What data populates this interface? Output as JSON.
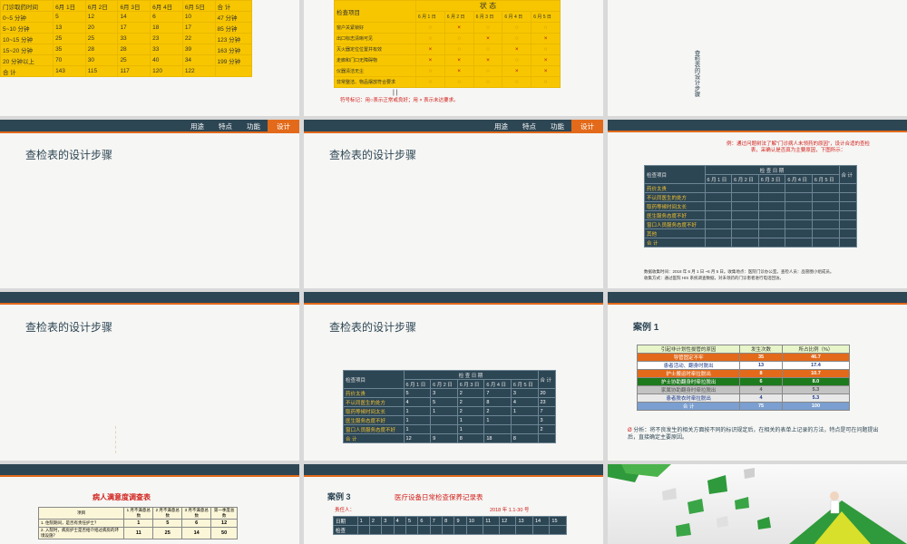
{
  "nav": {
    "items": [
      "用途",
      "特点",
      "功能",
      "设计"
    ]
  },
  "slide1": {
    "headers": [
      "门诊取药时间",
      "6月 1日",
      "6月 2日",
      "6月 3日",
      "6月 4日",
      "6月 5日",
      "合 计"
    ],
    "rows": [
      [
        "0~5 分钟",
        "5",
        "12",
        "14",
        "6",
        "10",
        "47 分钟"
      ],
      [
        "5~10 分钟",
        "13",
        "20",
        "17",
        "18",
        "17",
        "85 分钟"
      ],
      [
        "10~15 分钟",
        "25",
        "25",
        "33",
        "23",
        "22",
        "123 分钟"
      ],
      [
        "15~20 分钟",
        "35",
        "28",
        "28",
        "33",
        "39",
        "163 分钟"
      ],
      [
        "20 分钟以上",
        "70",
        "30",
        "25",
        "40",
        "34",
        "199 分钟"
      ],
      [
        "合 计",
        "143",
        "115",
        "117",
        "120",
        "122",
        ""
      ]
    ]
  },
  "slide2": {
    "item_header": "检查项目",
    "status_header": "状 态",
    "dates": [
      "6 月 1 日",
      "6 月 2 日",
      "6 月 3 日",
      "6 月 4 日",
      "6 月 5 日"
    ],
    "rows": [
      {
        "item": "窗户关紧锁好",
        "marks": [
          "○",
          "×",
          "○",
          "○",
          "○"
        ]
      },
      {
        "item": "出口标志清晰可见",
        "marks": [
          "○",
          "○",
          "×",
          "○",
          "×"
        ]
      },
      {
        "item": "灭火器定位位置并有效",
        "marks": [
          "×",
          "○",
          "○",
          "×",
          "○"
        ]
      },
      {
        "item": "走廊和门口无障碍物",
        "marks": [
          "×",
          "×",
          "×",
          "○",
          "×"
        ]
      },
      {
        "item": "仪器清洁无尘",
        "marks": [
          "○",
          "×",
          "○",
          "×",
          "×"
        ]
      },
      {
        "item": "非常整洁、物品摆放符合要求",
        "marks": [
          "○",
          "○",
          "○",
          "○",
          "○"
        ]
      }
    ],
    "note": "符号标记：用○表示正常或良好；用 × 表示未达要求。",
    "cursor": "| |"
  },
  "slide3": {
    "vertical": "查检表的设计步骤"
  },
  "steps_title": "查检表的设计步骤",
  "slide6": {
    "intro": "例：通过问题树法了解\"门诊病人未领药的原因\"，设计合适的查检表，采确认是否真为主要原因，下图所示：",
    "item_header": "检查项目",
    "period_header": "检 查 日 期",
    "dates": [
      "6 月 1 日",
      "6 月 2 日",
      "6 月 3 日",
      "6 月 4 日",
      "6 月 5 日"
    ],
    "total_header": "合 计",
    "items": [
      "药价太贵",
      "不认同医生的处方",
      "取药等候时间太长",
      "医生服务态度不好",
      "窗口人员服务态度不好",
      "其他",
      "合 计"
    ],
    "footnote1": "数据收集时间：2018 年 6 月 1 日 ~6 月 5 日。收集地点：医院门诊办公室。查检人员：品管圈小组成员。",
    "footnote2": "收集方式：通过医院 HIS 系统调查数据，对未领药的门诊患者进行电话回访。"
  },
  "slide8": {
    "item_header": "检查项目",
    "period_header": "检 查 日 期",
    "dates": [
      "6 月 1 日",
      "6 月 2 日",
      "6 月 3 日",
      "6 月 4 日",
      "6 月 5 日"
    ],
    "total_header": "合 计",
    "rows": [
      [
        "药价太贵",
        "5",
        "3",
        "2",
        "7",
        "3",
        "20"
      ],
      [
        "不认同医生的处方",
        "4",
        "5",
        "2",
        "8",
        "4",
        "23"
      ],
      [
        "取药等候时间太长",
        "1",
        "1",
        "2",
        "2",
        "1",
        "7"
      ],
      [
        "医生服务态度不好",
        "1",
        "",
        "1",
        "1",
        "",
        "3"
      ],
      [
        "窗口人员服务态度不好",
        "1",
        "",
        "1",
        "",
        "",
        "2"
      ],
      [
        "合 计",
        "12",
        "9",
        "8",
        "18",
        "8",
        ""
      ]
    ]
  },
  "slide9": {
    "title": "案例 1",
    "headers": [
      "引起非计划性拔管的原因",
      "发生次数",
      "所占比例（%）"
    ],
    "rows": [
      {
        "label": "导管固定不牢",
        "count": "35",
        "pct": "46.7",
        "bg": "#e26a1a",
        "fg": "#fff"
      },
      {
        "label": "患者活动、翻身时脱出",
        "count": "13",
        "pct": "17.4",
        "bg": "#ffffff",
        "fg": "#1a3a8a"
      },
      {
        "label": "护士搬运时牵拉脱出",
        "count": "8",
        "pct": "10.7",
        "bg": "#e26a1a",
        "fg": "#fff"
      },
      {
        "label": "护士协助翻身时牵拉脱出",
        "count": "6",
        "pct": "8.0",
        "bg": "#1d7a1d",
        "fg": "#fff"
      },
      {
        "label": "家属协助翻身时牵拉脱出",
        "count": "4",
        "pct": "5.3",
        "bg": "#c3c3c3",
        "fg": "#555"
      },
      {
        "label": "患者脱衣时牵拉脱出",
        "count": "4",
        "pct": "5.3",
        "bg": "#e8e8e8",
        "fg": "#1a3a8a"
      },
      {
        "label": "合 计",
        "count": "75",
        "pct": "100",
        "bg": "#7b9fd0",
        "fg": "#fff"
      }
    ],
    "analysis": "分析：将不良发生的相关方面按不同的标识规定后，在相关的表单上记录的方法，特点是可在问题提出后，直接确定主要原因。"
  },
  "slide10": {
    "title": "病人满意度调查表",
    "headers": [
      "项目",
      "1 月不满意总数",
      "2 月不满意总数",
      "3 月不满意总数",
      "第一季度总数"
    ],
    "rows": [
      [
        "1. 住院期间，是否有责任护士？",
        "1",
        "5",
        "6",
        "12"
      ],
      [
        "2. 入院时，病房护士是否给介绍过病房的环境设施？",
        "11",
        "25",
        "14",
        "50"
      ]
    ]
  },
  "slide11": {
    "case": "案例 3",
    "title": "医疗设备日常检查保养记录表",
    "responsible": "责任人：",
    "date_range": "2018 年 1.1-30 号",
    "row_label": "日期",
    "days": [
      "1",
      "2",
      "3",
      "4",
      "5",
      "6",
      "7",
      "8",
      "9",
      "10",
      "11",
      "12",
      "13",
      "14",
      "15"
    ],
    "row2": "检查"
  }
}
